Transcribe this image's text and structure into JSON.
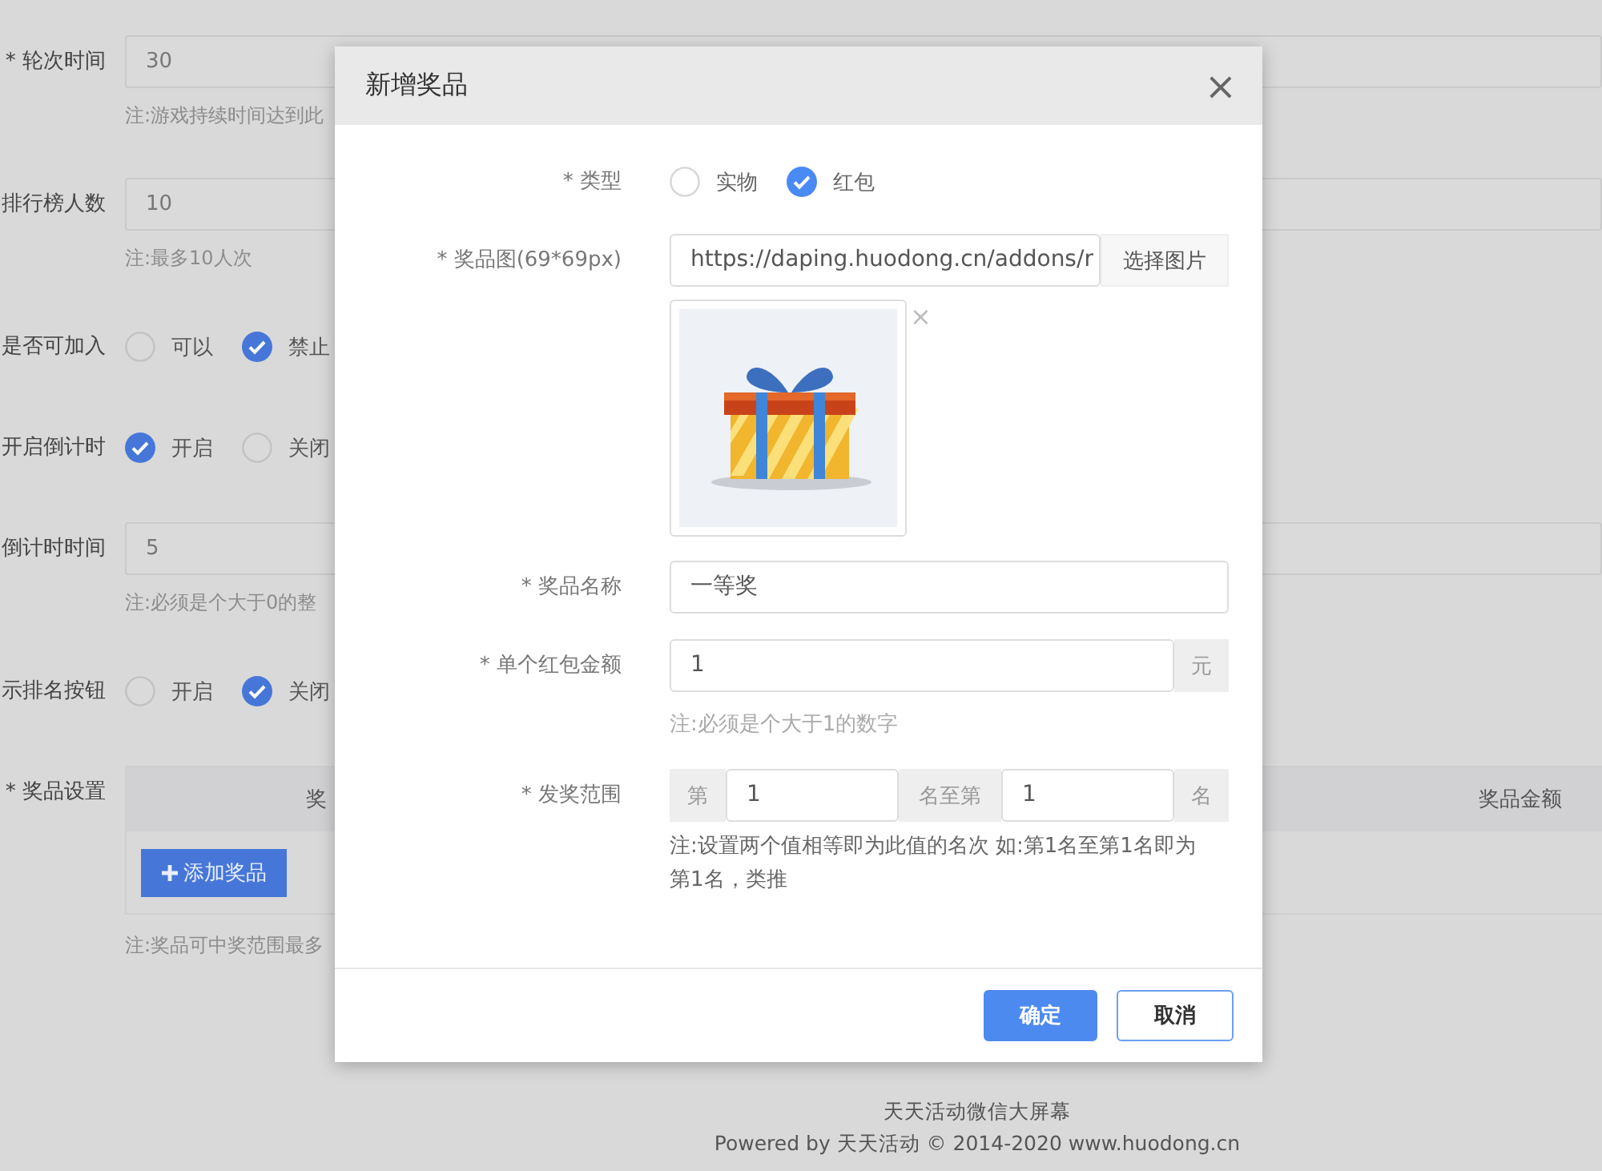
{
  "page": {
    "fields": [
      {
        "kind": "input",
        "label": "* 轮次时间",
        "value": "30",
        "hint": "注:游戏持续时间达到此"
      },
      {
        "kind": "input",
        "label": "排行榜人数",
        "value": "10",
        "hint": "注:最多10人次"
      },
      {
        "kind": "radio",
        "label": "是否可加入",
        "options": [
          {
            "label": "可以",
            "selected": false
          },
          {
            "label": "禁止",
            "selected": true
          }
        ]
      },
      {
        "kind": "radio",
        "label": "开启倒计时",
        "options": [
          {
            "label": "开启",
            "selected": true
          },
          {
            "label": "关闭",
            "selected": false
          }
        ]
      },
      {
        "kind": "input",
        "label": "倒计时时间",
        "value": "5",
        "hint": "注:必须是个大于0的整"
      },
      {
        "kind": "radio",
        "label": "示排名按钮",
        "options": [
          {
            "label": "开启",
            "selected": false
          },
          {
            "label": "关闭",
            "selected": true
          }
        ]
      },
      {
        "kind": "prizes",
        "label": "* 奖品设置",
        "columns": [
          "奖",
          "奖品金额"
        ],
        "add_button": "添加奖品",
        "hint": "注:奖品可中奖范围最多"
      }
    ]
  },
  "dialog": {
    "title": "新增奖品",
    "close": "×",
    "fields": [
      {
        "kind": "radio",
        "label": "* 类型",
        "options": [
          {
            "label": "实物",
            "selected": false
          },
          {
            "label": "红包",
            "selected": true
          }
        ]
      },
      {
        "label": "* 奖品图(69*69px)",
        "value": "https://daping.huodong.cn/addons/r",
        "button": "选择图片",
        "remove": "×"
      },
      {
        "kind": "input",
        "label": "* 奖品名称",
        "value": "一等奖"
      },
      {
        "kind": "addon",
        "label": "* 单个红包金额",
        "value": "1",
        "suffix": "元",
        "hint": "注:必须是个大于1的数字"
      },
      {
        "kind": "range",
        "label": "* 发奖范围",
        "prefix": "第",
        "from": "1",
        "middle": "名至第",
        "to": "1",
        "suffix": "名",
        "hint": "注:设置两个值相等即为此值的名次 如:第1名至第1名即为第1名，类推"
      }
    ],
    "buttons": [
      {
        "label": "确定",
        "primary": true
      },
      {
        "label": "取消",
        "primary": false
      }
    ]
  },
  "footer": {
    "lines": [
      "天天活动微信大屏幕",
      "Powered by 天天活动 © 2014-2020 www.huodong.cn"
    ]
  }
}
